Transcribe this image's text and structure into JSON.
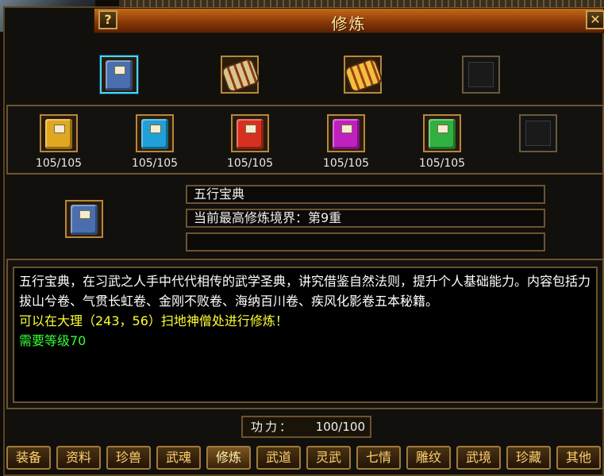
{
  "window": {
    "title": "修炼",
    "help_label": "?",
    "close_label": "✕"
  },
  "top_items": [
    {
      "icon": "five-elements-book-icon",
      "color": "#4a6fb0",
      "selected": true
    },
    {
      "icon": "scroll-bundle-icon",
      "color": "#8a3a1a",
      "selected": false
    },
    {
      "icon": "golden-scroll-icon",
      "color": "#d0801a",
      "selected": false
    },
    {
      "icon": "empty-slot-icon",
      "color": "#141414",
      "selected": false
    }
  ],
  "volumes": [
    {
      "icon": "yellow-book-icon",
      "color": "#e0a820",
      "count": "105/105"
    },
    {
      "icon": "blue-book-icon",
      "color": "#20a0d8",
      "count": "105/105"
    },
    {
      "icon": "red-book-icon",
      "color": "#d83020",
      "count": "105/105"
    },
    {
      "icon": "magenta-book-icon",
      "color": "#c020c0",
      "count": "105/105"
    },
    {
      "icon": "green-book-icon",
      "color": "#30b040",
      "count": "105/105"
    },
    {
      "icon": "empty-slot-icon",
      "color": "#141414",
      "count": ""
    }
  ],
  "info": {
    "name": "五行宝典",
    "realm": "当前最高修炼境界：第9重",
    "extra": ""
  },
  "description": {
    "text": "五行宝典，在习武之人手中代代相传的武学圣典，讲究借鉴自然法则，提升个人基础能力。内容包括力拔山兮卷、气贯长虹卷、金刚不败卷、海纳百川卷、疾风化影卷五本秘籍。",
    "location": "可以在大理（243，56）扫地神僧处进行修炼！",
    "requirement": "需要等级70"
  },
  "power": {
    "label": "功力：",
    "value": "100/100"
  },
  "tabs": [
    "装备",
    "资料",
    "珍兽",
    "武魂",
    "修炼",
    "武道",
    "灵武",
    "七情",
    "雕纹",
    "武境",
    "珍藏",
    "其他"
  ],
  "active_tab": "修炼"
}
